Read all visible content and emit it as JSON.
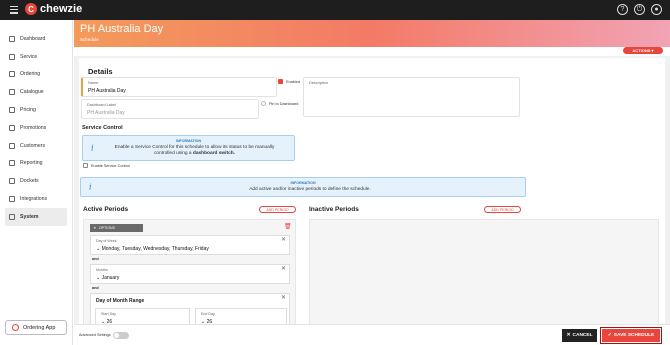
{
  "brand": {
    "name": "chewzie"
  },
  "header": {
    "title": "PH Australia Day",
    "subtitle": "Schedule",
    "actions_label": "ACTIONS"
  },
  "sidebar": {
    "items": [
      {
        "label": "Dashboard"
      },
      {
        "label": "Service"
      },
      {
        "label": "Ordering"
      },
      {
        "label": "Catalogue"
      },
      {
        "label": "Pricing"
      },
      {
        "label": "Promotions"
      },
      {
        "label": "Customers"
      },
      {
        "label": "Reporting"
      },
      {
        "label": "Dockets"
      },
      {
        "label": "Integrations"
      },
      {
        "label": "System"
      }
    ],
    "ordering_app_label": "Ordering App"
  },
  "details": {
    "heading": "Details",
    "name_label": "Name",
    "name_value": "PH Australia Day",
    "enabled_label": "Enabled",
    "description_label": "Description",
    "dashboard_label_label": "Dashboard Label",
    "dashboard_label_placeholder": "PH Australia Day",
    "pin_label": "Pin to Dashboard"
  },
  "service_control": {
    "heading": "Service Control",
    "info_head": "INFORMATION",
    "info_line1": "Enable a Service Control for this schedule to allow its status to be manually",
    "info_line2_prefix": "controlled using a ",
    "info_line2_bold": "dashboard switch.",
    "enable_label": "Enable Service Control"
  },
  "periods_info": {
    "head": "INFORMATION",
    "body": "Add active and/or inactive periods to define the schedule."
  },
  "active_periods": {
    "heading": "Active Periods",
    "add_label": "ADD PERIOD",
    "options_label": "OPTIONS",
    "day_of_week_label": "Day of Week",
    "day_of_week_value": "Monday, Tuesday, Wednesday, Thursday, Friday",
    "and1": "and",
    "months_label": "Months",
    "months_value": "January",
    "and2": "and",
    "dom_heading": "Day of Month Range",
    "start_day_label": "Start Day",
    "start_day_value": "26",
    "end_day_label": "End Day",
    "end_day_value": "26"
  },
  "inactive_periods": {
    "heading": "Inactive Periods",
    "add_label": "ADD PERIOD"
  },
  "footer": {
    "advanced_label": "Advanced Settings",
    "cancel_label": "CANCEL",
    "save_label": "SAVE SCHEDULE"
  },
  "colors": {
    "accent": "#e8453c",
    "info": "#2a7cc4",
    "topbar": "#1e1e1e"
  }
}
